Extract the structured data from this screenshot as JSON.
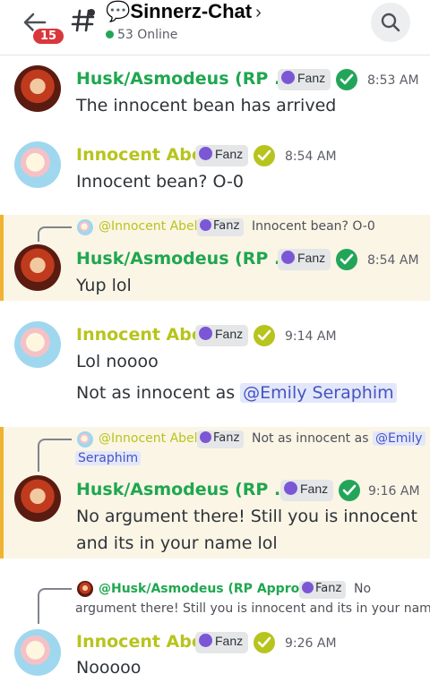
{
  "header": {
    "unread_count": "15",
    "channel_name": "💬Sinnerz-Chat",
    "chevron": "›",
    "online": "53 Online",
    "icons": [
      "back-arrow-icon",
      "hash-icon",
      "search-icon"
    ]
  },
  "colors": {
    "husk_name": "#1fa74f",
    "abel_name": "#b7c41d",
    "online_dot": "#23a559",
    "badge": "#da373c",
    "mention_bar": "#f0b232",
    "mention_bg": "#fbf5e6"
  },
  "messages": [
    {
      "author": "Husk/Asmodeus (RP ...",
      "tag": "Fanz",
      "time": "8:53 AM",
      "text": "The innocent bean has arrived"
    },
    {
      "author": "Innocent Abel",
      "tag": "Fanz",
      "time": "8:54 AM",
      "text": "Innocent bean? O-0"
    },
    {
      "reply_name": "@Innocent Abel",
      "reply_tag": "Fanz",
      "reply_text": "Innocent bean? O-0",
      "author": "Husk/Asmodeus (RP ...",
      "tag": "Fanz",
      "time": "8:54 AM",
      "text": "Yup lol"
    },
    {
      "author": "Innocent Abel",
      "tag": "Fanz",
      "time": "9:14 AM",
      "text": "Lol noooo",
      "text2_prefix": "Not as innocent as ",
      "text2_mention": "@Emily Seraphim"
    },
    {
      "reply_name": "@Innocent Abel",
      "reply_tag": "Fanz",
      "reply_text": "Not as innocent as ",
      "reply_mention_1": "@Emily",
      "reply_mention_2": "Seraphim",
      "author": "Husk/Asmodeus (RP ...",
      "tag": "Fanz",
      "time": "9:16 AM",
      "text": "No argument there! Still you is innocent",
      "text2": "and its in your name lol"
    },
    {
      "reply_name": "@Husk/Asmodeus (RP Approved)",
      "reply_tag": "Fanz",
      "reply_text": "No",
      "reply_text2": "argument there! Still you is innocent and its in your name",
      "author": "Innocent Abel",
      "tag": "Fanz",
      "time": "9:26 AM",
      "text": "Nooooo"
    }
  ]
}
